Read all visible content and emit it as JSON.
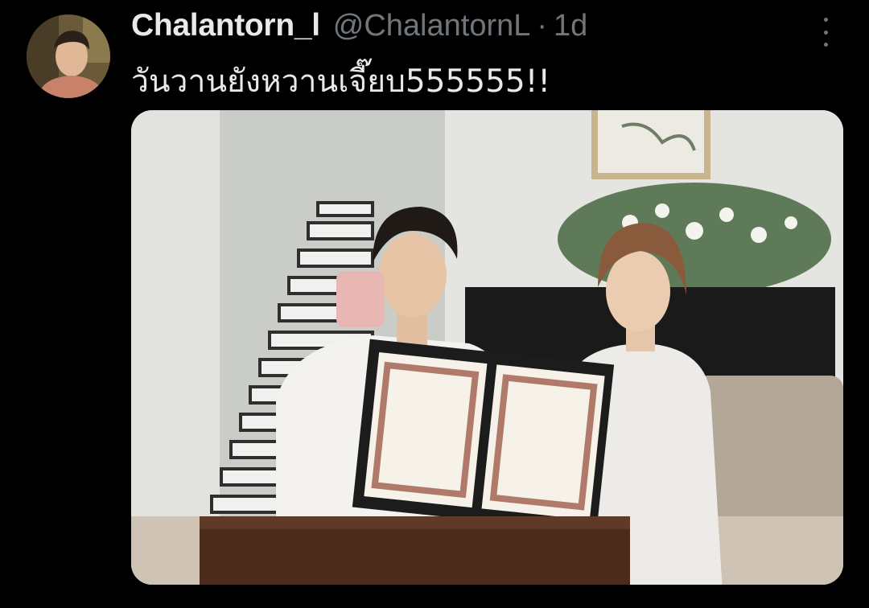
{
  "tweet": {
    "display_name": "Chalantorn_l",
    "handle": "@ChalantornL",
    "separator": "·",
    "time": "1d",
    "text": "วันวานยังหวานเจี๊ยบ555555!!"
  },
  "icons": {
    "more": "more-vertical-icon"
  },
  "colors": {
    "background": "#000000",
    "primary_text": "#e7e9ea",
    "secondary_text": "#71767b"
  }
}
